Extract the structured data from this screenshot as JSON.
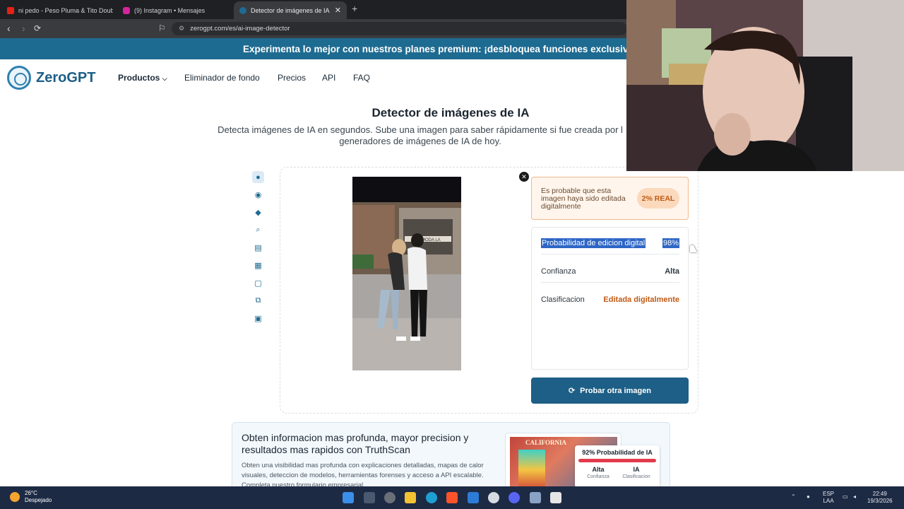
{
  "browser": {
    "tabs": [
      {
        "label": "ni pedo - Peso Pluma & Tito Double",
        "favicon_color": "#e62117"
      },
      {
        "label": "(9) Instagram • Mensajes",
        "favicon_color": "#d6249f"
      },
      {
        "label": "Detector de imágenes de IA - De",
        "favicon_color": "#1e6b91"
      }
    ],
    "url": "zerogpt.com/es/ai-image-detector"
  },
  "promo_banner": "Experimenta lo mejor con nuestros planes premium: ¡desbloquea funciones exclusivas a",
  "header": {
    "logo": "ZeroGPT",
    "nav": [
      "Productos",
      "Eliminador de fondo",
      "Precios",
      "API",
      "FAQ"
    ]
  },
  "hero": {
    "title": "Detector de imágenes de IA",
    "subtitle_line1": "Detecta imágenes de IA en segundos. Sube una imagen para saber rápidamente si fue creada por l",
    "subtitle_line2": "generadores de imágenes de IA de hoy."
  },
  "result": {
    "verdict": "Es probable que esta imagen haya sido editada digitalmente",
    "real_badge": "2% REAL",
    "rows": [
      {
        "label": "Probabilidad de edicion digital",
        "value": "98%"
      },
      {
        "label": "Confianza",
        "value": "Alta"
      },
      {
        "label": "Clasificacion",
        "value": "Editada digitalmente"
      }
    ],
    "cta": "Probar otra imagen",
    "photo_sign": "MODA LA"
  },
  "truthscan": {
    "title": "Obten informacion mas profunda, mayor precision y resultados mas rapidos con TruthScan",
    "body": "Obten una visibilidad mas profunda con explicaciones detalladas, mapas de calor visuales, deteccion de modelos, herramientas forenses y acceso a API escalable. Completa nuestro formulario empresarial",
    "license_label": "CALIFORNIA",
    "badge_title": "92% Probabilidad de IA",
    "badge_col1_value": "Alta",
    "badge_col1_label": "Confianza",
    "badge_col2_value": "IA",
    "badge_col2_label": "Clasificacion"
  },
  "taskbar": {
    "temp": "26°C",
    "weather": "Despejado",
    "lang1": "ESP",
    "lang2": "LAA",
    "time": "22:49",
    "date": "19/3/2026"
  },
  "colors": {
    "accent": "#1d5f86",
    "banner": "#1e6b91",
    "warn": "#c05a14"
  }
}
